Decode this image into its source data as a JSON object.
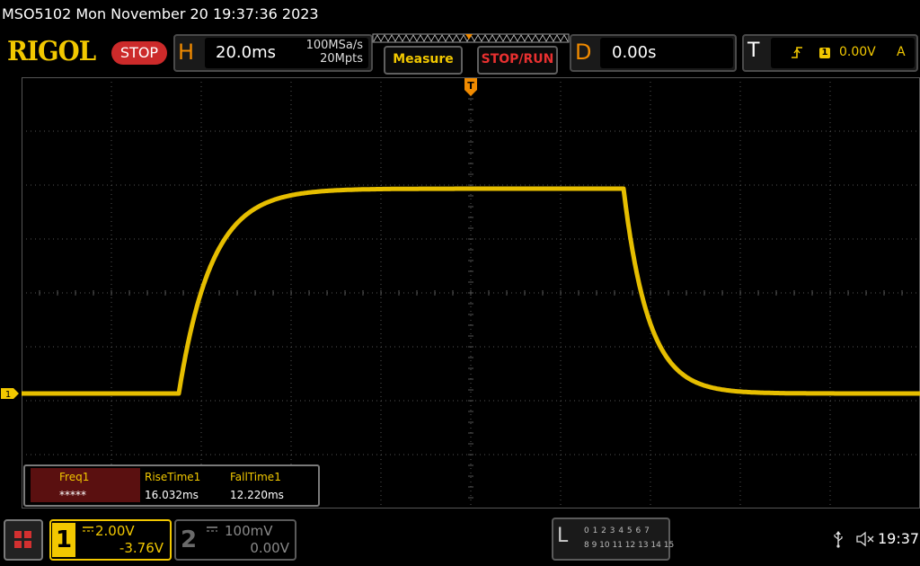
{
  "header": {
    "title": "MSO5102  Mon November 20 19:37:36 2023",
    "logo": "RIGOL",
    "run_state": "STOP"
  },
  "horizontal": {
    "letter": "H",
    "timebase": "20.0ms",
    "sample_rate": "100MSa/s",
    "memory_depth": "20Mpts"
  },
  "buttons": {
    "measure": "Measure",
    "stop_run": "STOP/RUN"
  },
  "delay": {
    "letter": "D",
    "value": "0.00s"
  },
  "trigger": {
    "letter": "T",
    "source": "1",
    "level": "0.00V",
    "mode": "A"
  },
  "markers": {
    "trigger_position": "T",
    "ch1": "1"
  },
  "measurements": [
    {
      "name": "Freq1",
      "value": "*****"
    },
    {
      "name": "RiseTime1",
      "value": "16.032ms"
    },
    {
      "name": "FallTime1",
      "value": "12.220ms"
    }
  ],
  "channels": {
    "ch1": {
      "number": "1",
      "scale": "2.00V",
      "offset": "-3.76V"
    },
    "ch2": {
      "number": "2",
      "scale": "100mV",
      "offset": "0.00V"
    }
  },
  "logic_analyzer": {
    "letter": "L",
    "row1": "0 1 2 3  4 5 6 7",
    "row2": "8 9 10 11 12 13 14 15"
  },
  "status": {
    "clock": "19:37"
  },
  "colors": {
    "ch1": "#f2c800",
    "trigger": "#f08a00",
    "stop": "#cc2a2a",
    "grid": "#555555"
  },
  "waveform": {
    "channel": "1",
    "shape": "pulse",
    "low_level_divisions": 0,
    "high_level_divisions": 3.8,
    "rise_start_time_ms": -65,
    "fall_start_time_ms": 34,
    "rise_time_ms": 16.032,
    "fall_time_ms": 12.22
  }
}
